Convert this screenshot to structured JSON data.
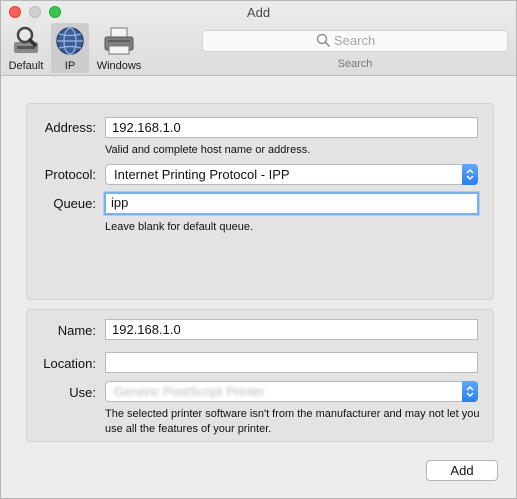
{
  "window": {
    "title": "Add"
  },
  "toolbar": {
    "items": [
      {
        "label": "Default",
        "icon": "magnifier-printer-icon"
      },
      {
        "label": "IP",
        "icon": "globe-icon",
        "selected": true
      },
      {
        "label": "Windows",
        "icon": "printer-icon"
      }
    ],
    "search": {
      "placeholder": "Search",
      "caption": "Search"
    }
  },
  "ip_panel": {
    "address": {
      "label": "Address:",
      "value": "192.168.1.0",
      "note": "Valid and complete host name or address."
    },
    "protocol": {
      "label": "Protocol:",
      "value": "Internet Printing Protocol - IPP"
    },
    "queue": {
      "label": "Queue:",
      "value": "ipp",
      "note": "Leave blank for default queue."
    }
  },
  "printer_panel": {
    "name": {
      "label": "Name:",
      "value": "192.168.1.0"
    },
    "location": {
      "label": "Location:",
      "value": ""
    },
    "use": {
      "label": "Use:",
      "value": "Generic PostScript Printer",
      "note": "The selected printer software isn't from the manufacturer and may not let you use all the features of your printer."
    }
  },
  "add_button": {
    "label": "Add"
  },
  "colors": {
    "accent": "#2a7ff0",
    "close": "#fc5f57",
    "zoom": "#35c84a"
  }
}
